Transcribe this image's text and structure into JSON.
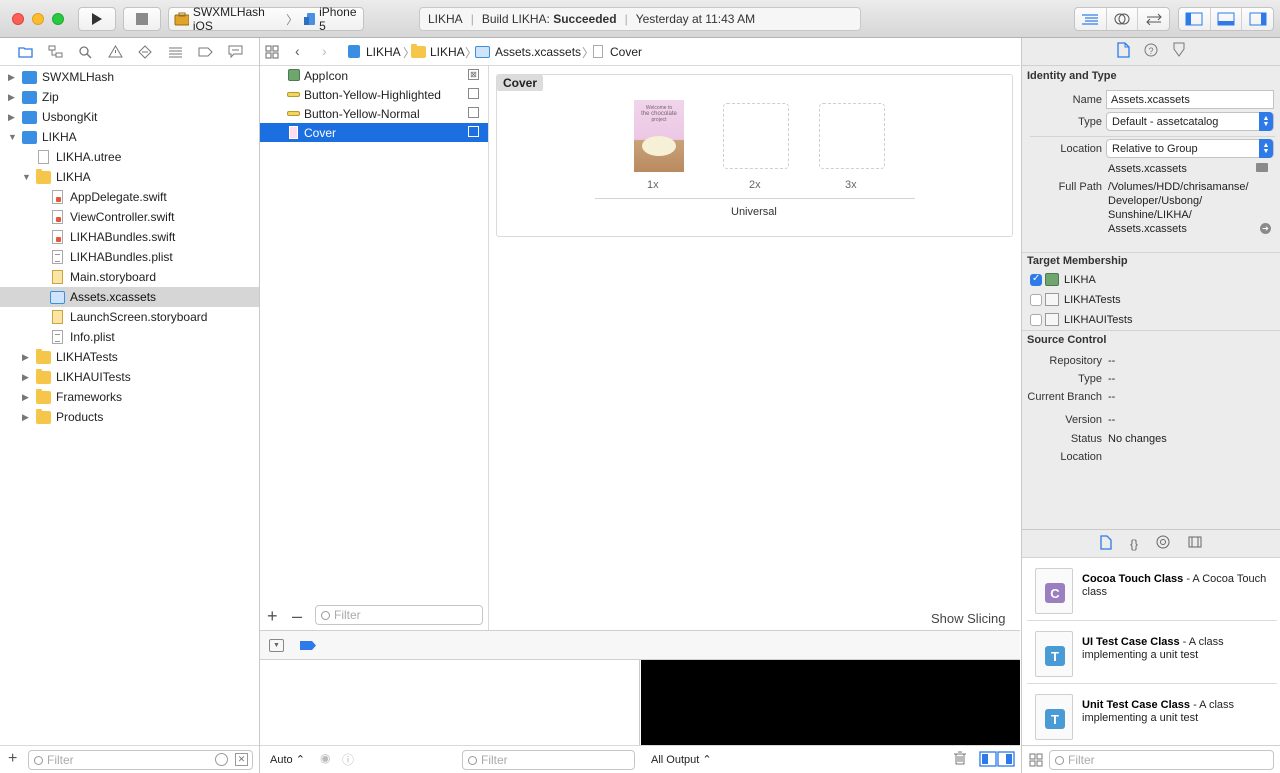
{
  "toolbar": {
    "scheme": "SWXMLHash iOS",
    "device": "iPhone 5",
    "status": {
      "project": "LIKHA",
      "build_prefix": "Build LIKHA: ",
      "build_result": "Succeeded",
      "time": "Yesterday at 11:43 AM"
    }
  },
  "navigator": {
    "items": [
      {
        "label": "SWXMLHash",
        "icon": "project-icon",
        "disclosure": "▶"
      },
      {
        "label": "Zip",
        "icon": "project-icon",
        "disclosure": "▶"
      },
      {
        "label": "UsbongKit",
        "icon": "project-icon",
        "disclosure": "▶"
      },
      {
        "label": "LIKHA",
        "icon": "project-icon",
        "disclosure": "▼"
      },
      {
        "label": "LIKHA.utree",
        "icon": "document-icon"
      },
      {
        "label": "LIKHA",
        "icon": "folder-icon",
        "disclosure": "▼"
      },
      {
        "label": "AppDelegate.swift",
        "icon": "swift-file-icon"
      },
      {
        "label": "ViewController.swift",
        "icon": "swift-file-icon"
      },
      {
        "label": "LIKHABundles.swift",
        "icon": "swift-file-icon"
      },
      {
        "label": "LIKHABundles.plist",
        "icon": "plist-file-icon"
      },
      {
        "label": "Main.storyboard",
        "icon": "storyboard-icon"
      },
      {
        "label": "Assets.xcassets",
        "icon": "asset-catalog-icon"
      },
      {
        "label": "LaunchScreen.storyboard",
        "icon": "storyboard-icon"
      },
      {
        "label": "Info.plist",
        "icon": "plist-file-icon"
      },
      {
        "label": "LIKHATests",
        "icon": "folder-icon",
        "disclosure": "▶"
      },
      {
        "label": "LIKHAUITests",
        "icon": "folder-icon",
        "disclosure": "▶"
      },
      {
        "label": "Frameworks",
        "icon": "folder-icon",
        "disclosure": "▶"
      },
      {
        "label": "Products",
        "icon": "folder-icon",
        "disclosure": "▶"
      }
    ],
    "filter_placeholder": "Filter"
  },
  "jumpbar": {
    "crumbs": [
      "LIKHA",
      "LIKHA",
      "Assets.xcassets",
      "Cover"
    ]
  },
  "assets": {
    "items": [
      "AppIcon",
      "Button-Yellow-Highlighted",
      "Button-Yellow-Normal",
      "Cover"
    ],
    "filter_placeholder": "Filter"
  },
  "canvas": {
    "set_name": "Cover",
    "image_text": [
      "Welcome to",
      "the chocolate",
      "project"
    ],
    "slots": [
      "1x",
      "2x",
      "3x"
    ],
    "group_label": "Universal",
    "show_slicing": "Show Slicing"
  },
  "debug": {
    "auto": "Auto",
    "filter_placeholder": "Filter",
    "output": "All Output"
  },
  "inspector": {
    "identity_title": "Identity and Type",
    "name_label": "Name",
    "name_value": "Assets.xcassets",
    "type_label": "Type",
    "type_value": "Default - assetcatalog",
    "location_label": "Location",
    "location_value": "Relative to Group",
    "location_file": "Assets.xcassets",
    "fullpath_label": "Full Path",
    "fullpath_lines": [
      "/Volumes/HDD/chrisamanse/",
      "Developer/Usbong/",
      "Sunshine/LIKHA/",
      "Assets.xcassets"
    ],
    "membership_title": "Target Membership",
    "targets": [
      {
        "label": "LIKHA",
        "checked": true
      },
      {
        "label": "LIKHATests",
        "checked": false
      },
      {
        "label": "LIKHAUITests",
        "checked": false
      }
    ],
    "source_title": "Source Control",
    "repository_label": "Repository",
    "repository_value": "--",
    "sc_type_label": "Type",
    "sc_type_value": "--",
    "branch_label": "Current Branch",
    "branch_value": "--",
    "version_label": "Version",
    "version_value": "--",
    "status_label": "Status",
    "status_value": "No changes",
    "sc_location_label": "Location"
  },
  "library": {
    "items": [
      {
        "icon_letter": "C",
        "icon_color": "#9b7fc0",
        "title": "Cocoa Touch Class",
        "desc": " - A Cocoa Touch class"
      },
      {
        "icon_letter": "T",
        "icon_color": "#4a9ad6",
        "title": "UI Test Case Class",
        "desc": " - A class implementing a unit test"
      },
      {
        "icon_letter": "T",
        "icon_color": "#4a9ad6",
        "title": "Unit Test Case Class",
        "desc": " - A class implementing a unit test"
      }
    ],
    "filter_placeholder": "Filter"
  }
}
